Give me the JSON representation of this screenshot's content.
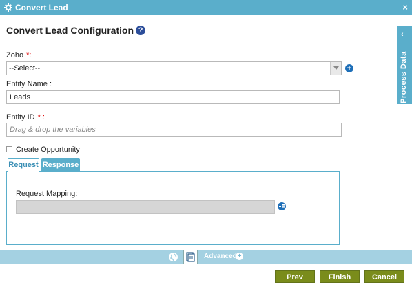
{
  "window": {
    "title": "Convert Lead",
    "close_symbol": "×"
  },
  "form": {
    "heading": "Convert Lead Configuration",
    "help_symbol": "?",
    "zoho": {
      "label": "Zoho",
      "required_mark": "*:",
      "selected": "--Select--"
    },
    "entity_name": {
      "label": "Entity Name :",
      "value": "Leads"
    },
    "entity_id": {
      "label": "Entity ID",
      "required_mark": "* :",
      "placeholder": "Drag & drop the variables"
    },
    "create_opportunity": {
      "label": "Create Opportunity",
      "checked": false
    }
  },
  "tabs": [
    {
      "label": "Request",
      "active": true
    },
    {
      "label": "Response",
      "active": false
    }
  ],
  "request": {
    "mapping_label": "Request Mapping:"
  },
  "side_panel": {
    "label": "Process Data"
  },
  "advanced": {
    "label": "Advanced"
  },
  "buttons": {
    "prev": "Prev",
    "finish": "Finish",
    "cancel": "Cancel"
  },
  "colors": {
    "header": "#5aaecb",
    "button": "#7a8c1b",
    "advanced_bar": "#a4d1e2"
  }
}
